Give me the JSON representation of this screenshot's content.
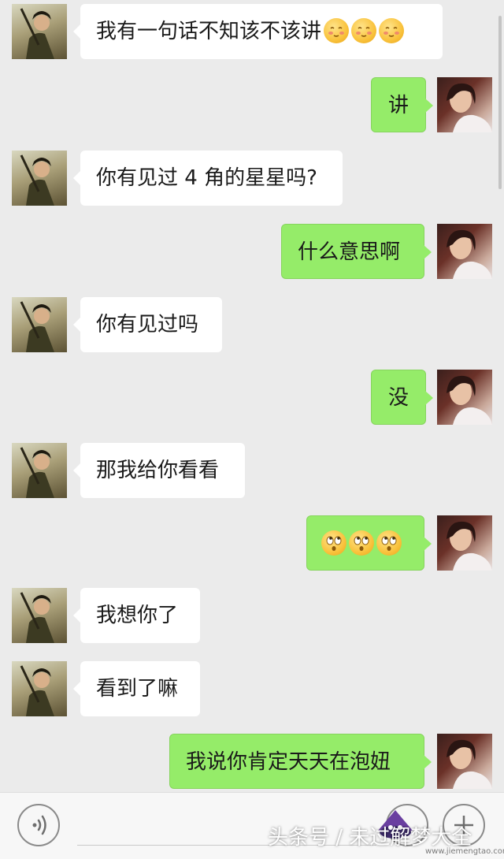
{
  "messages": [
    {
      "side": "left",
      "text": "我有一句话不知该不该讲",
      "emoji_count": 3,
      "emoji_name": "blush-emoji"
    },
    {
      "side": "right",
      "text": "讲"
    },
    {
      "side": "left",
      "text": "你有见过 4 角的星星吗?"
    },
    {
      "side": "right",
      "text": "什么意思啊"
    },
    {
      "side": "left",
      "text": "你有见过吗"
    },
    {
      "side": "right",
      "text": "没"
    },
    {
      "side": "left",
      "text": "那我给你看看"
    },
    {
      "side": "right",
      "text": "",
      "emoji_count": 3,
      "emoji_name": "eyes-rolling-emoji"
    },
    {
      "side": "left",
      "text": "我想你了"
    },
    {
      "side": "left",
      "text": "看到了嘛"
    },
    {
      "side": "right",
      "text": "我说你肯定天天在泡妞"
    }
  ],
  "toolbar": {
    "voice_icon": "voice-icon",
    "emoji_icon": "smiley-icon",
    "plus_icon": "plus-icon"
  },
  "watermark": {
    "text": "头条号 / 未过解梦大全",
    "logo_text": "解梦大全",
    "site": "www.jiemengtao.com"
  },
  "colors": {
    "background": "#ebebeb",
    "bubble_incoming": "#ffffff",
    "bubble_outgoing": "#95ec69"
  }
}
